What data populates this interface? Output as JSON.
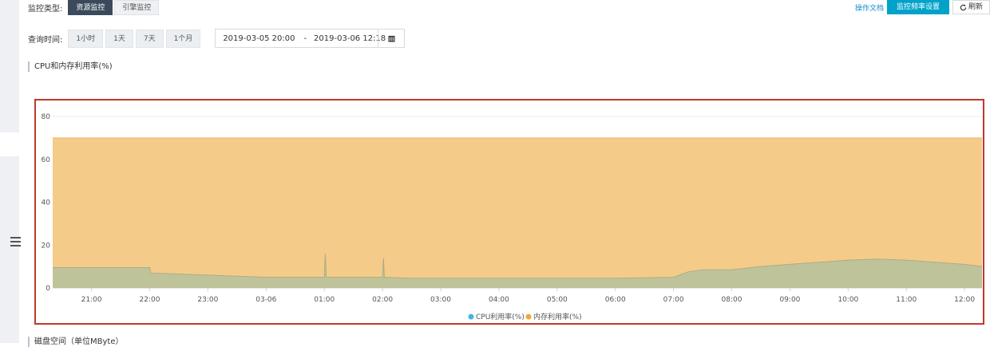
{
  "monitor_type": {
    "label": "监控类型:",
    "tabs": [
      {
        "label": "资源监控",
        "active": true
      },
      {
        "label": "引擎监控",
        "active": false
      }
    ]
  },
  "toolbar": {
    "doc_link": "操作文档",
    "frequency_button": "监控频率设置",
    "refresh_button": "刷新"
  },
  "query": {
    "label": "查询时间:",
    "ranges": [
      "1小时",
      "1天",
      "7天",
      "1个月"
    ],
    "start": "2019-03-05 20:00",
    "separator": "-",
    "end": "2019-03-06 12:18"
  },
  "section_title": "CPU和内存利用率(%)",
  "next_section_title": "磁盘空间（单位MByte）",
  "colors": {
    "memory": "#f5cb8a",
    "cpu": "#bfc39a",
    "cpu_legend": "#41b6e6",
    "memory_legend": "#f0a83a",
    "border": "#c0392b"
  },
  "chart_data": {
    "type": "area",
    "title": "",
    "x_tick_labels": [
      "21:00",
      "22:00",
      "23:00",
      "03-06",
      "01:00",
      "02:00",
      "03:00",
      "04:00",
      "05:00",
      "06:00",
      "07:00",
      "08:00",
      "09:00",
      "10:00",
      "11:00",
      "12:00"
    ],
    "x_range": [
      "2019-03-05 20:20",
      "2019-03-06 12:18"
    ],
    "y_ticks": [
      0,
      20,
      40,
      60,
      80
    ],
    "ylim": [
      0,
      80
    ],
    "grid": true,
    "legend_position": "bottom",
    "series": [
      {
        "name": "CPU利用率(%)",
        "x": [
          "20:20",
          "21:00",
          "21:30",
          "22:00",
          "22:01",
          "22:30",
          "23:00",
          "23:30",
          "00:00",
          "00:30",
          "01:00",
          "01:01",
          "01:02",
          "01:30",
          "02:00",
          "02:01",
          "02:02",
          "02:30",
          "03:00",
          "04:00",
          "05:00",
          "06:00",
          "07:00",
          "07:15",
          "07:30",
          "08:00",
          "08:30",
          "09:00",
          "09:30",
          "10:00",
          "10:30",
          "11:00",
          "11:30",
          "12:00",
          "12:18"
        ],
        "values": [
          9.5,
          9.5,
          9.5,
          9.5,
          7,
          6.5,
          6,
          5.5,
          5,
          5,
          5,
          16,
          5,
          5,
          5,
          14,
          5,
          4.5,
          4.5,
          4.5,
          4.5,
          4.5,
          5,
          7.5,
          8.5,
          8.5,
          10,
          11,
          12,
          13,
          13.5,
          13,
          12,
          11,
          10
        ]
      },
      {
        "name": "内存利用率(%)",
        "x": [
          "20:20",
          "12:18"
        ],
        "values": [
          70,
          70
        ]
      }
    ]
  }
}
